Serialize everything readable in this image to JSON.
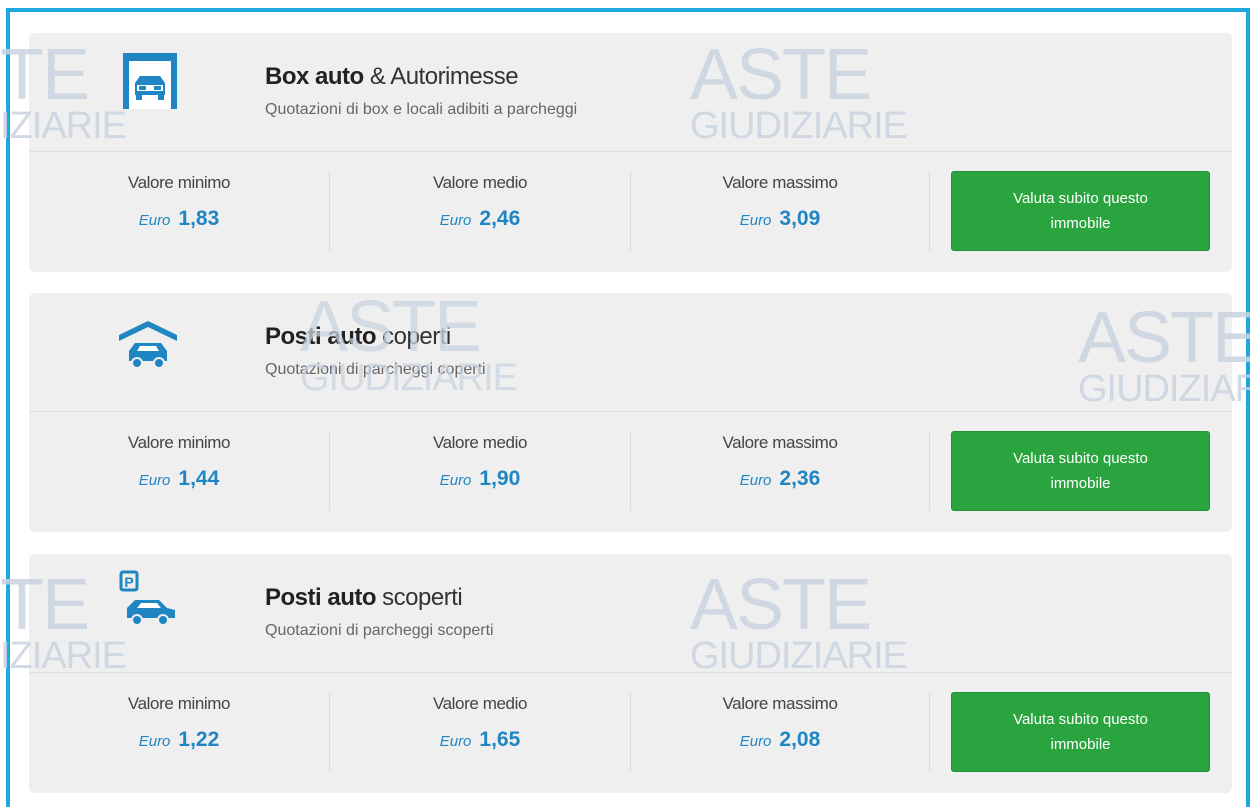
{
  "watermark": {
    "line1": "ASTE",
    "line2": "GIUDIZIARIE",
    "partial_line1": "TE",
    "partial_line2": "IZIARIE"
  },
  "accent_colors": {
    "frame": "#1fa7e0",
    "value": "#1f86c3",
    "button": "#2aa43f"
  },
  "cards": [
    {
      "icon": "garage-box-car-icon",
      "title_bold": "Box auto",
      "title_rest": " & Autorimesse",
      "subtitle": "Quotazioni di box e locali adibiti a parcheggi",
      "min_label": "Valore minimo",
      "min_currency": "Euro",
      "min_value": "1,83",
      "mid_label": "Valore medio",
      "mid_currency": "Euro",
      "mid_value": "2,46",
      "max_label": "Valore massimo",
      "max_currency": "Euro",
      "max_value": "3,09",
      "button": "Valuta subito questo immobile"
    },
    {
      "icon": "covered-parking-car-icon",
      "title_bold": "Posti auto",
      "title_rest": " coperti",
      "subtitle": "Quotazioni di parcheggi coperti",
      "min_label": "Valore minimo",
      "min_currency": "Euro",
      "min_value": "1,44",
      "mid_label": "Valore medio",
      "mid_currency": "Euro",
      "mid_value": "1,90",
      "max_label": "Valore massimo",
      "max_currency": "Euro",
      "max_value": "2,36",
      "button": "Valuta subito questo immobile"
    },
    {
      "icon": "open-parking-car-icon",
      "icon_text": "P",
      "title_bold": "Posti auto",
      "title_rest": " scoperti",
      "subtitle": "Quotazioni di parcheggi scoperti",
      "min_label": "Valore minimo",
      "min_currency": "Euro",
      "min_value": "1,22",
      "mid_label": "Valore medio",
      "mid_currency": "Euro",
      "mid_value": "1,65",
      "max_label": "Valore massimo",
      "max_currency": "Euro",
      "max_value": "2,08",
      "button": "Valuta subito questo immobile"
    }
  ]
}
